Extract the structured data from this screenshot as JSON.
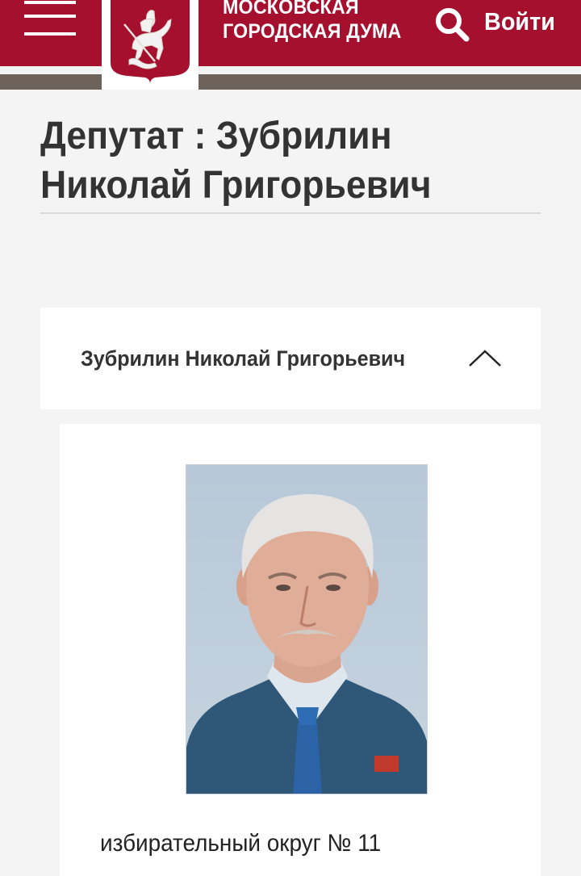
{
  "header": {
    "brand_line1": "МОСКОВСКАЯ",
    "brand_line2": "ГОРОДСКАЯ ДУМА",
    "login_label": "Войти",
    "colors": {
      "primary": "#a6102f",
      "strip": "#6e635b"
    },
    "icons": [
      "menu-icon",
      "coat-of-arms-logo",
      "search-icon"
    ]
  },
  "page": {
    "title": "Депутат : Зубрилин Николай Григорьевич"
  },
  "accordion": {
    "title": "Зубрилин Николай Григорьевич",
    "expanded": true,
    "icon": "chevron-up-icon"
  },
  "panel": {
    "photo_alt_icon": "deputy-portrait",
    "district": "избирательный округ № 11"
  }
}
